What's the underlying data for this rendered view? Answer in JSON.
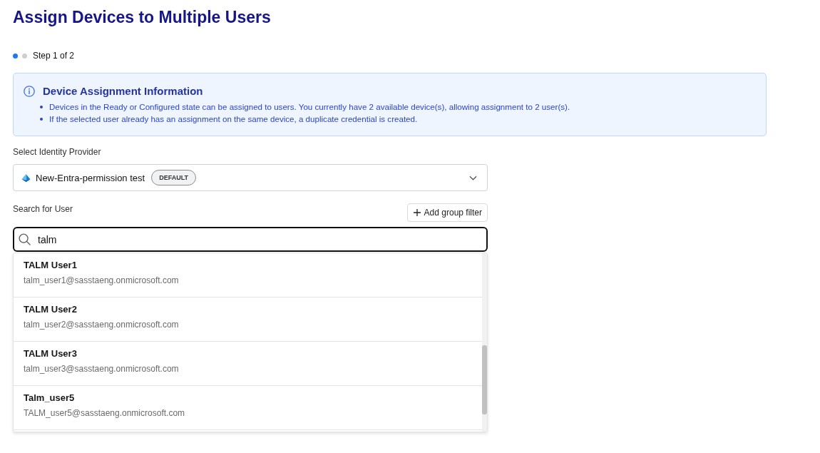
{
  "page": {
    "title": "Assign Devices to Multiple Users"
  },
  "stepper": {
    "steps": [
      {
        "selected": true
      },
      {
        "selected": false
      }
    ],
    "label": "Step 1 of 2"
  },
  "info_panel": {
    "title": "Device Assignment Information",
    "items": [
      "Devices in the Ready or Configured state can be assigned to users. You currently have 2 available device(s), allowing assignment to 2 user(s).",
      "If the selected user already has an assignment on the same device, a duplicate credential is created."
    ]
  },
  "identity_provider": {
    "label": "Select Identity Provider",
    "value": "New-Entra-permission test",
    "badge": "DEFAULT"
  },
  "user_search": {
    "label": "Search for User",
    "add_filter_button": "Add group filter",
    "value": "talm",
    "results": [
      {
        "name": "TALM User1",
        "email": "talm_user1@sasstaeng.onmicrosoft.com"
      },
      {
        "name": "TALM User2",
        "email": "talm_user2@sasstaeng.onmicrosoft.com"
      },
      {
        "name": "TALM User3",
        "email": "talm_user3@sasstaeng.onmicrosoft.com"
      },
      {
        "name": "Talm_user5",
        "email": "TALM_user5@sasstaeng.onmicrosoft.com"
      }
    ]
  }
}
